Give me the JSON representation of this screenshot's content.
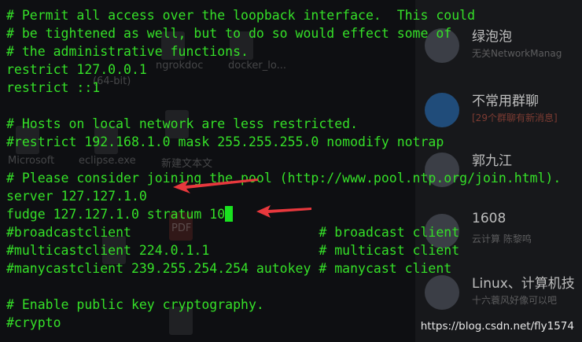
{
  "terminal": {
    "lines": [
      {
        "text": "# Permit all access over the loopback interface.  This could",
        "style": "comment"
      },
      {
        "text": "# be tightened as well, but to do so would effect some of",
        "style": "comment"
      },
      {
        "text": "# the administrative functions.",
        "style": "comment"
      },
      {
        "text": "restrict 127.0.0.1",
        "style": "command"
      },
      {
        "text": "restrict ::1",
        "style": "command"
      },
      {
        "text": "",
        "style": "blank"
      },
      {
        "text": "# Hosts on local network are less restricted.",
        "style": "comment"
      },
      {
        "text": "#restrict 192.168.1.0 mask 255.255.255.0 nomodify notrap",
        "style": "comment"
      },
      {
        "text": "",
        "style": "blank"
      },
      {
        "text": "# Please consider joining the pool (http://www.pool.ntp.org/join.html).",
        "style": "comment"
      },
      {
        "text": "server 127.127.1.0",
        "style": "command"
      },
      {
        "text": "fudge 127.127.1.0 stratum 10",
        "style": "command"
      },
      {
        "text": "#broadcastclient                        # broadcast client",
        "style": "comment"
      },
      {
        "text": "#multicastclient 224.0.1.1              # multicast client",
        "style": "comment"
      },
      {
        "text": "#manycastclient 239.255.254.254 autokey # manycast client",
        "style": "comment"
      },
      {
        "text": "",
        "style": "blank"
      },
      {
        "text": "# Enable public key cryptography.",
        "style": "comment"
      },
      {
        "text": "#crypto",
        "style": "comment"
      }
    ],
    "text_color": "#35e028",
    "cursor_color": "#19e21f",
    "annotation_color": "#e8383d"
  },
  "background": {
    "desktop_labels": [
      "ngrokdoc",
      "docker_lo...",
      "(64-bit)",
      "Microsoft",
      "eclipse.exe",
      "新建文本文",
      "PDF"
    ],
    "chat_list": [
      {
        "name": "绿泡泡",
        "sub": "无关NetworkManag"
      },
      {
        "name": "不常用群聊",
        "sub": "[29个群聊有新消息]"
      },
      {
        "name": "郭九江",
        "sub": ""
      },
      {
        "name": "1608",
        "sub": "云计算 陈黎鸣"
      },
      {
        "name": "Linux、计算机技",
        "sub": "十六蓑风好像可以吧"
      }
    ]
  },
  "watermark": "https://blog.csdn.net/fly1574"
}
